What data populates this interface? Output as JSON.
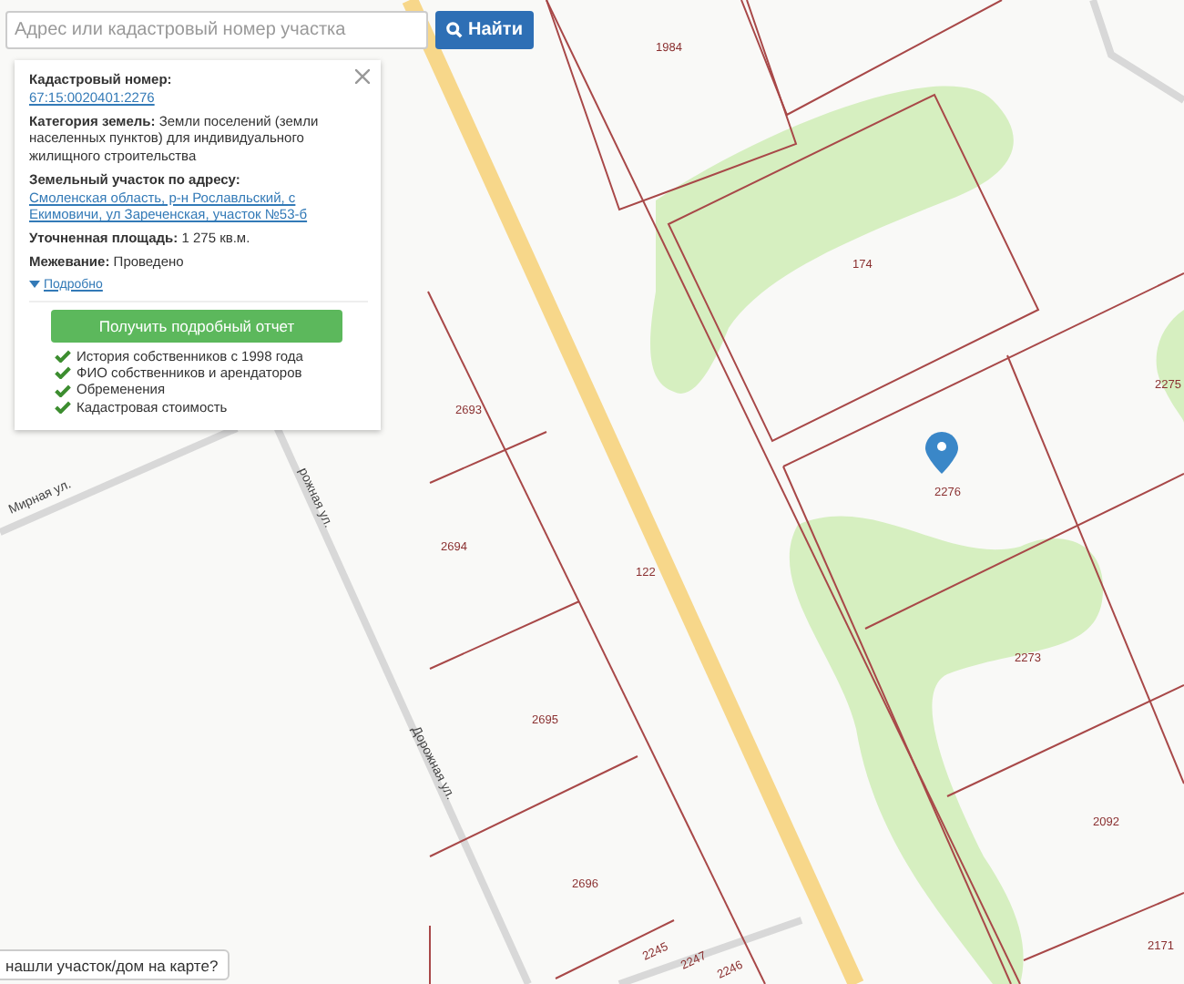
{
  "search": {
    "placeholder": "Адрес или кадастровый номер участка",
    "button": "Найти"
  },
  "info_panel": {
    "fields": [
      {
        "label": "Кадастровый номер:",
        "value": "67:15:0020401:2276",
        "kind": "link"
      },
      {
        "label": "Категория земель:",
        "value": "Земли поселений (земли населенных пунктов) для индивидуального жилищного строительства",
        "kind": "text"
      },
      {
        "label": "Земельный участок по адресу:",
        "value": "Смоленская область, р-н Рославльский, с Екимовичи, ул Зареченская, участок №53-б",
        "kind": "link"
      },
      {
        "label": "Уточненная площадь:",
        "value": "1 275 кв.м.",
        "kind": "text"
      },
      {
        "label": "Межевание:",
        "value": "Проведено",
        "kind": "text"
      }
    ],
    "more_link": "Подробно",
    "expanded": false,
    "report_button": "Получить подробный отчет",
    "features": [
      "История собственников с 1998 года",
      "ФИО собственников и арендаторов",
      "Обременения",
      "Кадастровая стоимость"
    ]
  },
  "map": {
    "parcel_labels": [
      "1984",
      "174",
      "2275",
      "2276",
      "2693",
      "2694",
      "122",
      "2695",
      "2273",
      "2092",
      "2696",
      "2245",
      "2247",
      "2246",
      "2171"
    ],
    "street_labels": [
      "Мирная ул.",
      "рожная ул.",
      "Дорожная ул."
    ]
  },
  "help_button": "нашли участок/дом на карте?"
}
